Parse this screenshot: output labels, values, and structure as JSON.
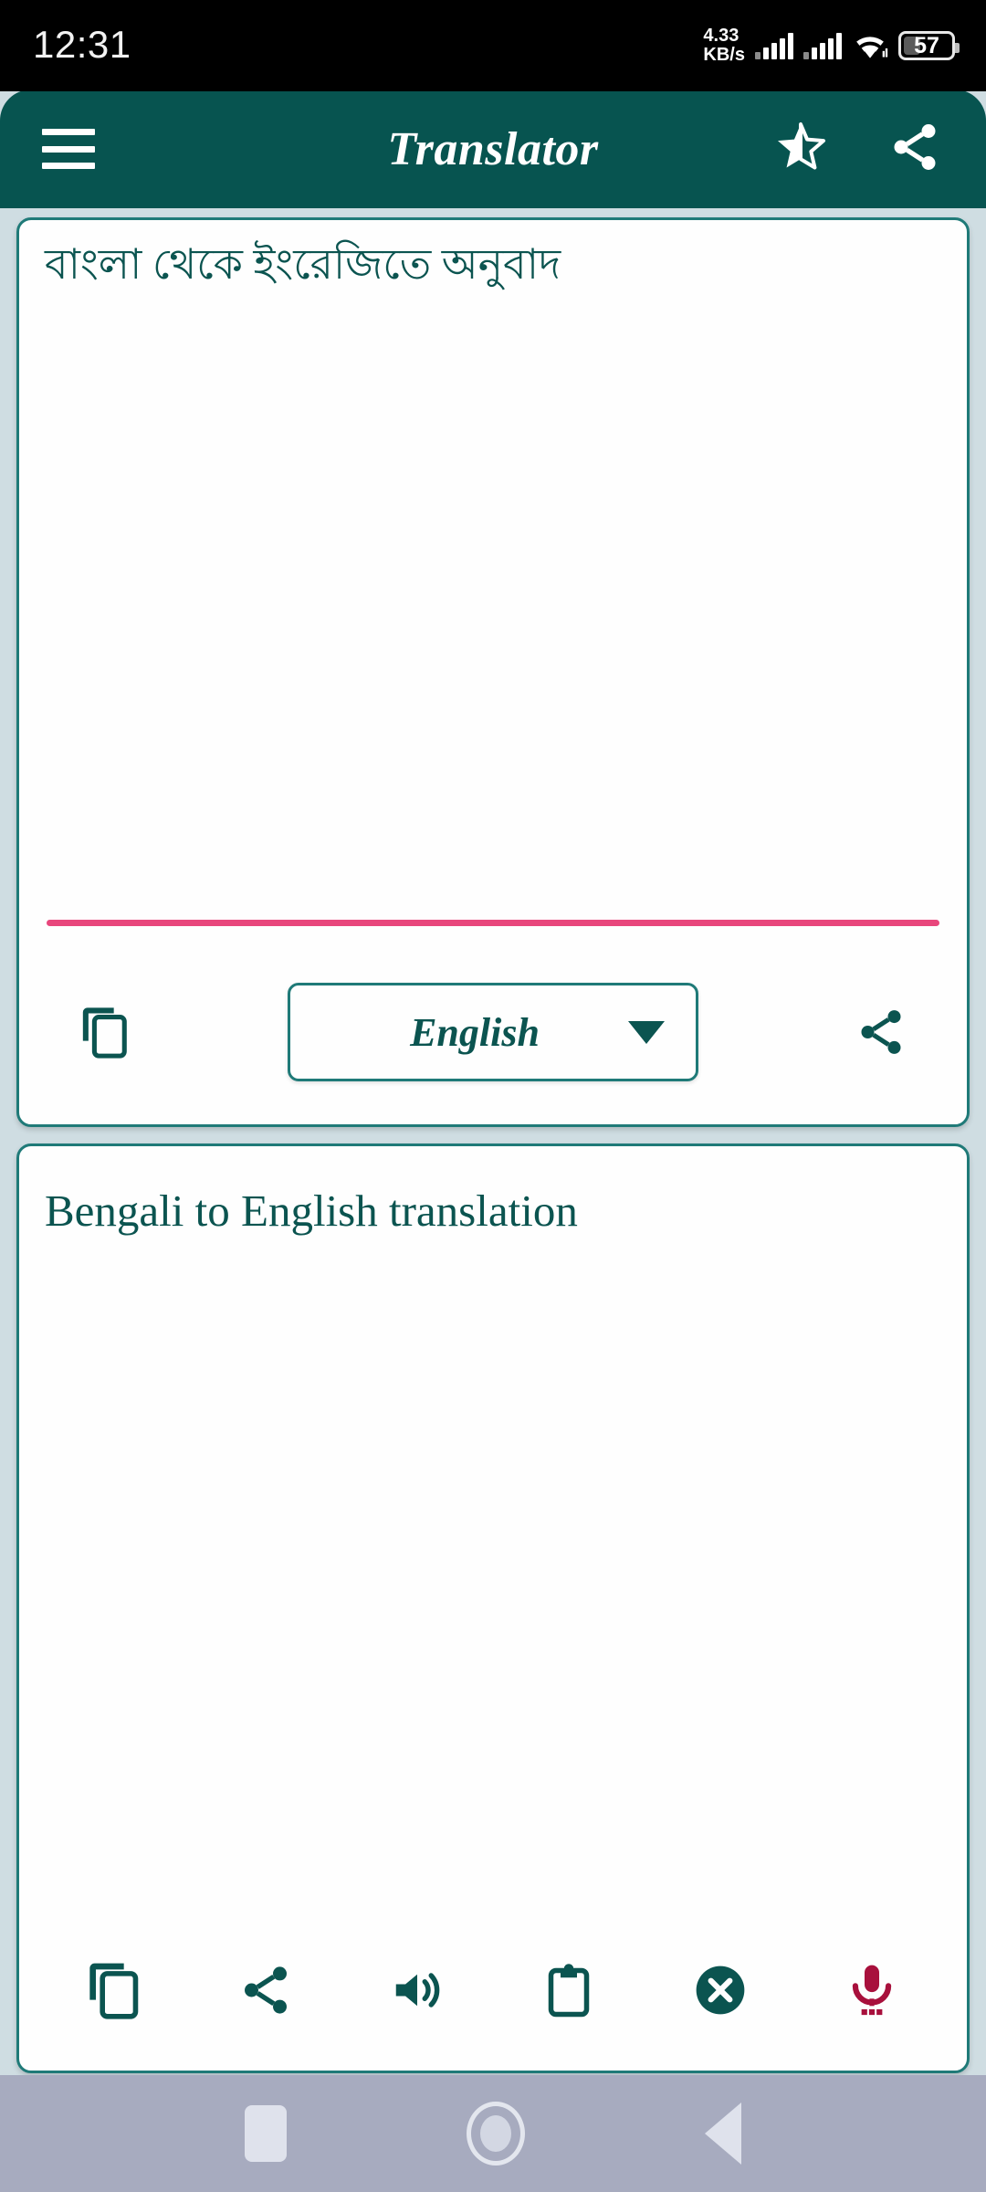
{
  "status_bar": {
    "time": "12:31",
    "network_speed_value": "4.33",
    "network_speed_unit": "KB/s",
    "signal_icon_1": "signal-bars-icon",
    "signal_icon_2": "signal-bars-icon",
    "wifi_icon": "wifi-icon",
    "battery_percent": "57",
    "battery_icon": "battery-icon"
  },
  "app_bar": {
    "menu_icon": "hamburger-menu-icon",
    "title": "Translator",
    "rate_icon": "star-half-icon",
    "share_icon": "share-icon",
    "background_color": "#075450",
    "title_color": "#ffffff"
  },
  "input_panel": {
    "source_text": "বাংলা থেকে ইংরেজিতে অনুবাদ",
    "divider_color": "#e8467c",
    "copy_icon": "copy-icon",
    "share_icon": "share-icon",
    "language_selector": {
      "selected": "English",
      "caret_icon": "chevron-down-icon"
    }
  },
  "output_panel": {
    "result_text": "Bengali to English translation",
    "toolbar": [
      {
        "icon": "copy-icon",
        "label": "Copy"
      },
      {
        "icon": "share-icon",
        "label": "Share"
      },
      {
        "icon": "speaker-icon",
        "label": "Speak"
      },
      {
        "icon": "clipboard-icon",
        "label": "Paste"
      },
      {
        "icon": "clear-circle-icon",
        "label": "Clear"
      },
      {
        "icon": "microphone-icon",
        "label": "Voice input"
      }
    ]
  },
  "nav_bar": {
    "recents_icon": "recents-square-icon",
    "home_icon": "home-circle-icon",
    "back_icon": "back-triangle-icon",
    "background_color": "#a7abbf"
  },
  "theme": {
    "primary": "#075450",
    "border": "#1f7a78",
    "page_background": "#cfdde2",
    "accent_pink": "#e8467c",
    "accent_crimson": "#a8103c"
  }
}
